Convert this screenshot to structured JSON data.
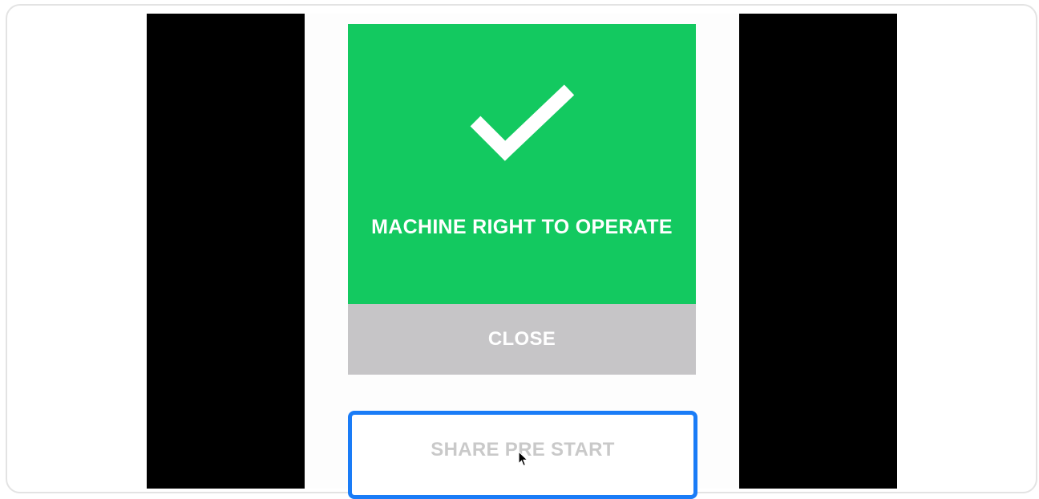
{
  "status_card": {
    "icon": "checkmark-icon",
    "title": "MACHINE RIGHT TO OPERATE",
    "color": "#13c960"
  },
  "close_button": {
    "label": "CLOSE",
    "color": "#c6c5c7"
  },
  "share_button": {
    "label": "SHARE PRE START",
    "border_color": "#1a7cf7"
  },
  "pointer": {
    "icon": "mouse-pointer-icon"
  }
}
